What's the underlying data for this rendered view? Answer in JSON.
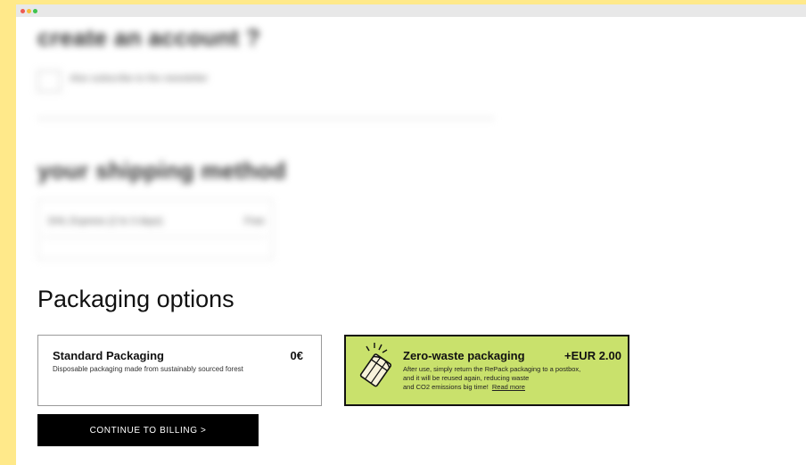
{
  "account_section": {
    "heading": "create an account ?",
    "checkbox_label": "Also subscribe to the newsletter"
  },
  "shipping_section": {
    "heading": "your shipping method",
    "method_name": "DHL Express (2 to 3 days)",
    "method_price": "Free"
  },
  "packaging": {
    "title": "Packaging options",
    "standard": {
      "name": "Standard Packaging",
      "price": "0€",
      "description": "Disposable packaging made from sustainably sourced forest"
    },
    "zero_waste": {
      "name": "Zero-waste packaging",
      "price": "+EUR 2.00",
      "description_lines": [
        "After use, simply return the RePack packaging to a postbox,",
        "and it will be reused again, reducing waste",
        "and CO2 emissions big time!"
      ],
      "read_more": "Read more",
      "icon": "repack-bag-icon",
      "background": "#c9e16c"
    }
  },
  "continue_button": "CONTINUE TO BILLING >"
}
